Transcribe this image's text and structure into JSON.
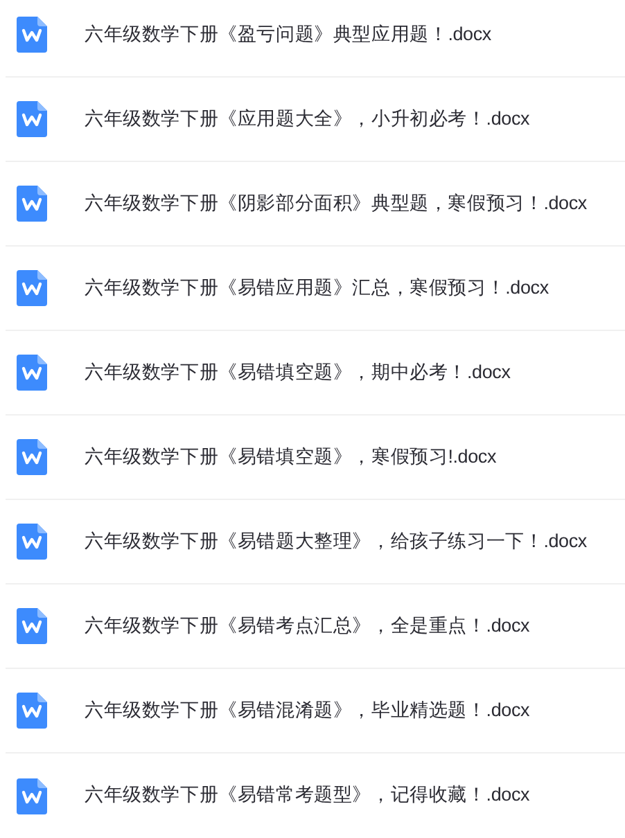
{
  "files": [
    {
      "name": "六年级数学下册《盈亏问题》典型应用题！.docx"
    },
    {
      "name": "六年级数学下册《应用题大全》，小升初必考！.docx"
    },
    {
      "name": "六年级数学下册《阴影部分面积》典型题，寒假预习！.docx"
    },
    {
      "name": "六年级数学下册《易错应用题》汇总，寒假预习！.docx"
    },
    {
      "name": "六年级数学下册《易错填空题》，期中必考！.docx"
    },
    {
      "name": "六年级数学下册《易错填空题》，寒假预习!.docx"
    },
    {
      "name": "六年级数学下册《易错题大整理》，给孩子练习一下！.docx"
    },
    {
      "name": "六年级数学下册《易错考点汇总》，全是重点！.docx"
    },
    {
      "name": "六年级数学下册《易错混淆题》，毕业精选题！.docx"
    },
    {
      "name": "六年级数学下册《易错常考题型》，记得收藏！.docx"
    }
  ]
}
